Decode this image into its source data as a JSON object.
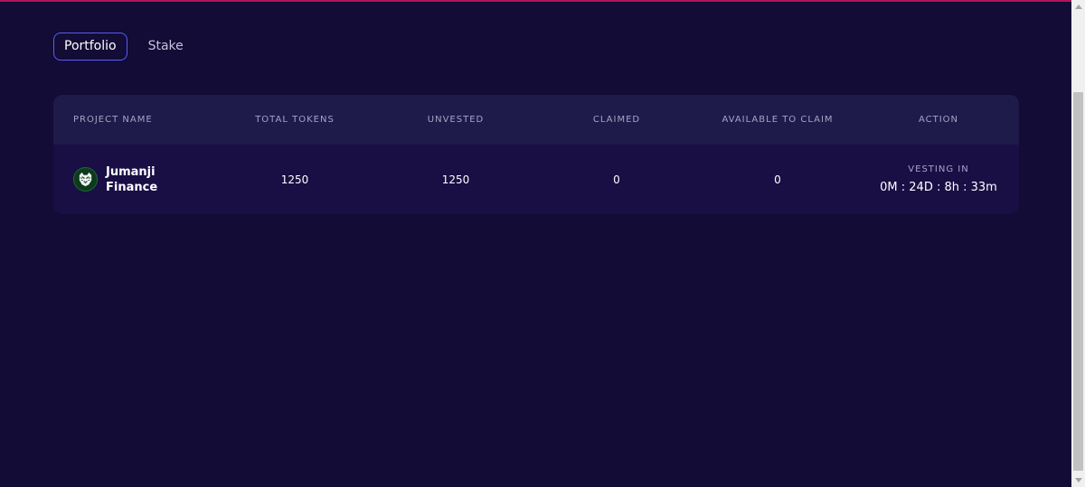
{
  "tabs": [
    {
      "label": "Portfolio",
      "active": true
    },
    {
      "label": "Stake",
      "active": false
    }
  ],
  "table": {
    "headers": [
      "PROJECT NAME",
      "TOTAL TOKENS",
      "UNVESTED",
      "CLAIMED",
      "AVAILABLE TO CLAIM",
      "ACTION"
    ],
    "rows": [
      {
        "project_name": "Jumanji Finance",
        "logo_icon": "tiger-icon",
        "total_tokens": "1250",
        "unvested": "1250",
        "claimed": "0",
        "available_to_claim": "0",
        "action_title": "VESTING IN",
        "action_timer": "0M : 24D : 8h : 33m"
      }
    ]
  },
  "colors": {
    "background": "#120c36",
    "card": "#190f45",
    "header": "#1e1a4a",
    "accent_border": "#5a5cf0",
    "top_accent": "#b0145a"
  }
}
